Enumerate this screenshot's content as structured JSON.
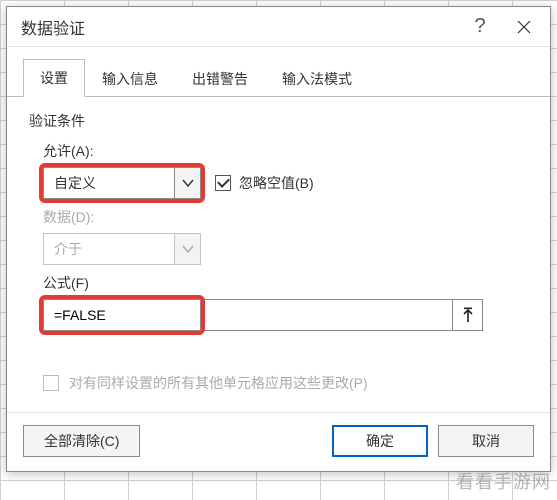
{
  "dialog": {
    "title": "数据验证",
    "help_icon": "help-icon",
    "close_icon": "close-icon"
  },
  "tabs": {
    "items": [
      {
        "label": "设置",
        "active": true
      },
      {
        "label": "输入信息",
        "active": false
      },
      {
        "label": "出错警告",
        "active": false
      },
      {
        "label": "输入法模式",
        "active": false
      }
    ]
  },
  "content": {
    "section_title": "验证条件",
    "allow_label": "允许(A):",
    "allow_value": "自定义",
    "ignore_blank_label": "忽略空值(B)",
    "ignore_blank_checked": true,
    "data_label": "数据(D):",
    "data_value": "介于",
    "formula_label": "公式(F)",
    "formula_value": "=FALSE",
    "apply_all_label": "对有同样设置的所有其他单元格应用这些更改(P)",
    "apply_all_checked": false
  },
  "footer": {
    "clear_all_label": "全部清除(C)",
    "ok_label": "确定",
    "cancel_label": "取消"
  },
  "watermark": "看看手游网"
}
